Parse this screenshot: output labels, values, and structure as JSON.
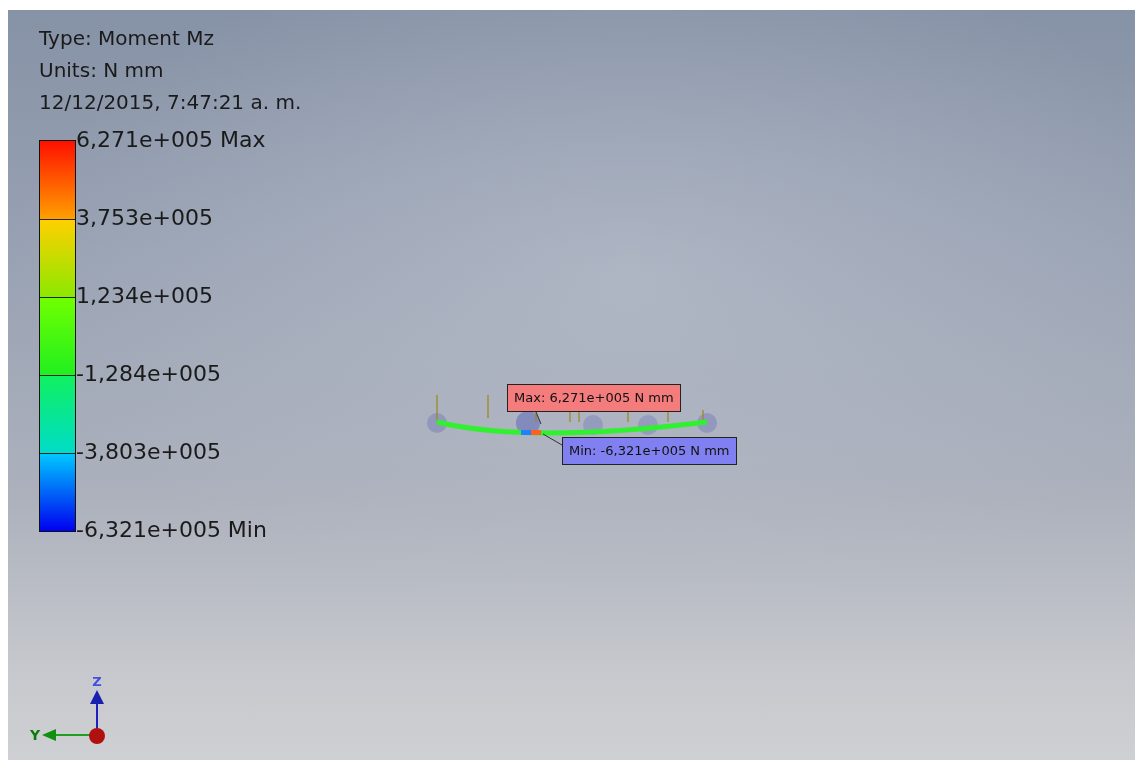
{
  "info": {
    "type": "Type: Moment Mz",
    "units": "Units: N mm",
    "timestamp": "12/12/2015, 7:47:21 a. m."
  },
  "legend": {
    "labels": [
      "6,271e+005 Max",
      "3,753e+005",
      "1,234e+005",
      "-1,284e+005",
      "-3,803e+005",
      "-6,321e+005 Min"
    ]
  },
  "probes": [
    {
      "kind": "max",
      "label": "Max: 6,271e+005 N mm",
      "color": "#f47c7c"
    },
    {
      "kind": "min",
      "label": "Min: -6,321e+005 N mm",
      "color": "#8080f0"
    }
  ],
  "axes": {
    "z": "Z",
    "y": "Y"
  }
}
